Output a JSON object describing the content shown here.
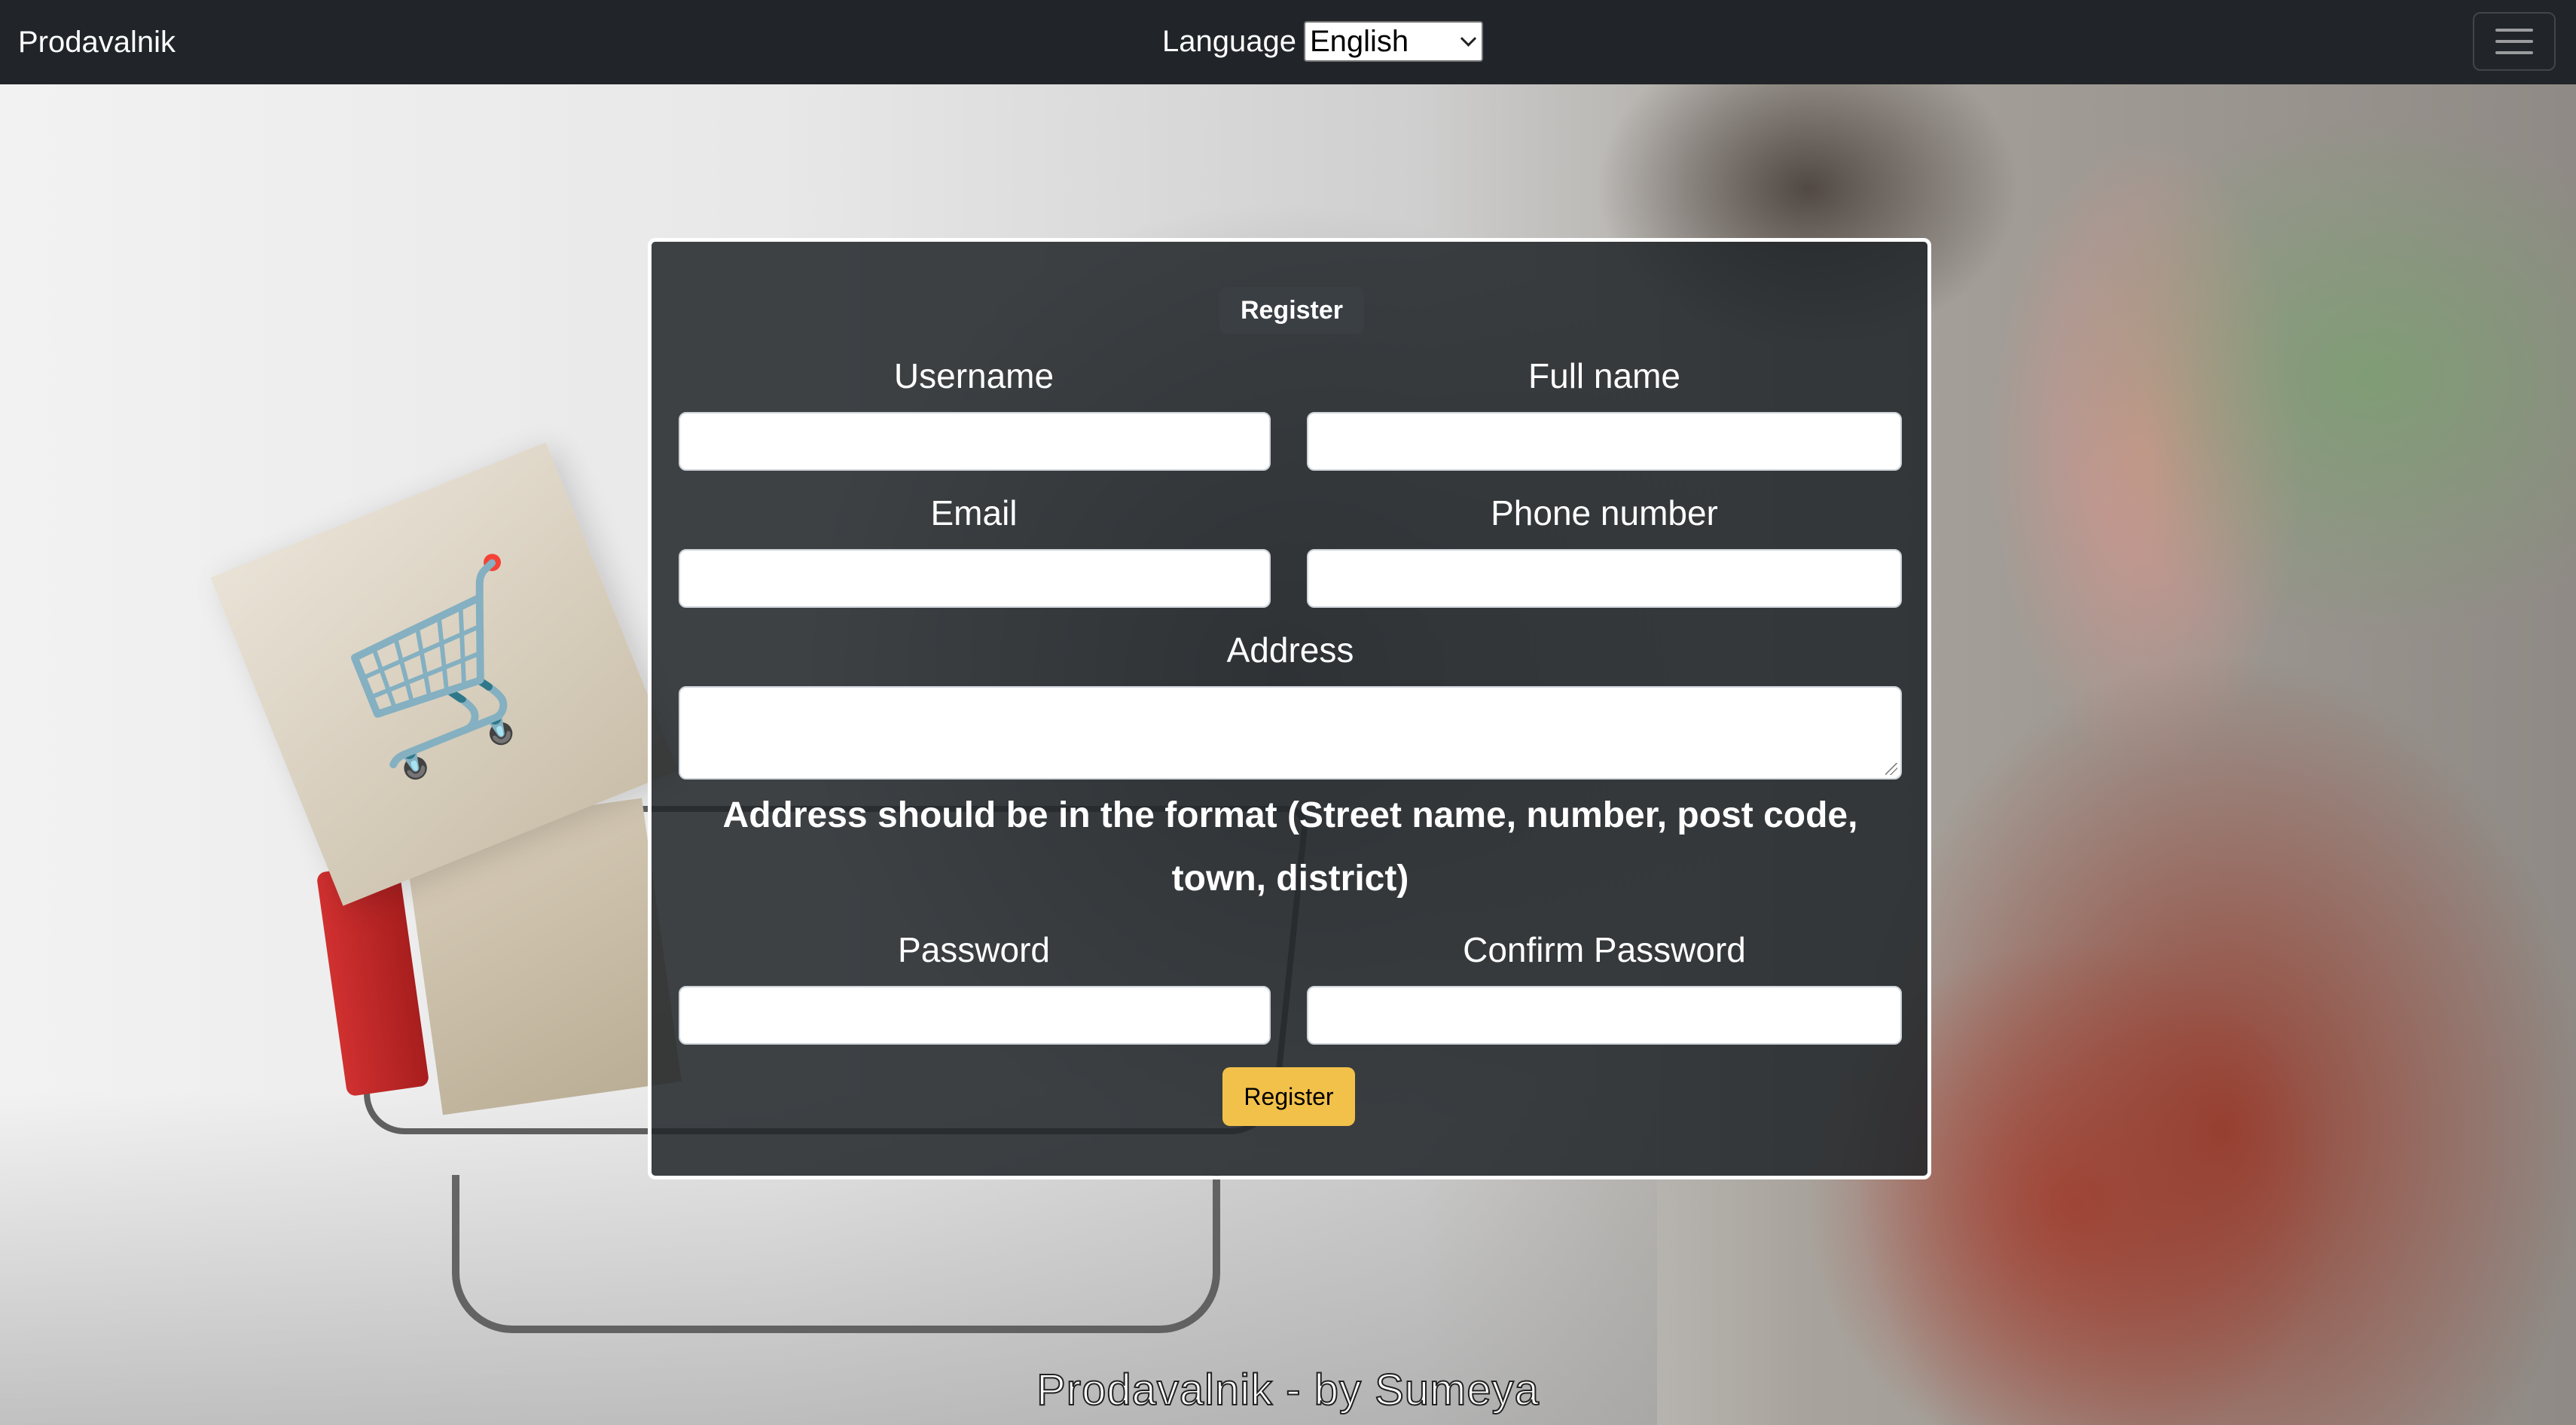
{
  "navbar": {
    "brand": "Prodavalnik",
    "language_label": "Language",
    "language_selected": "English",
    "menu_icon": "hamburger-icon"
  },
  "form": {
    "badge": "Register",
    "username_label": "Username",
    "fullname_label": "Full name",
    "email_label": "Email",
    "phone_label": "Phone number",
    "address_label": "Address",
    "address_hint": "Address should be in the format (Street name, number, post code, town, district)",
    "password_label": "Password",
    "confirm_password_label": "Confirm Password",
    "submit_label": "Register",
    "username_value": "",
    "fullname_value": "",
    "email_value": "",
    "phone_value": "",
    "address_value": "",
    "password_value": "",
    "confirm_password_value": ""
  },
  "footer": {
    "text": "Prodavalnik - by Sumeya"
  },
  "colors": {
    "navbar_bg": "#212529",
    "card_bg": "rgba(33,37,41,0.86)",
    "submit_bg": "#f2c14a",
    "badge_bg": "#3a3f44"
  }
}
